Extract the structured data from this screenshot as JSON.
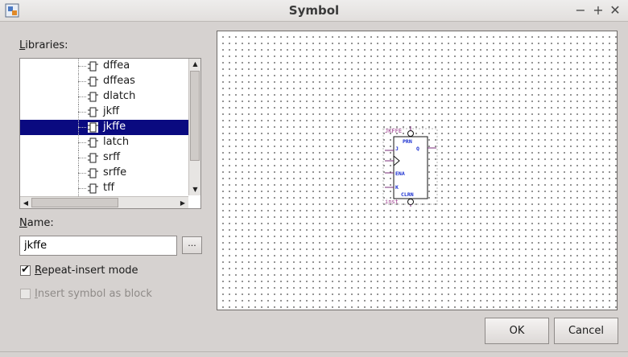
{
  "window": {
    "title": "Symbol",
    "controls": {
      "minimize": "−",
      "maximize": "+",
      "close": "✕"
    }
  },
  "libraries": {
    "label": "Libraries:",
    "label_underline": "L",
    "label_rest": "ibraries:",
    "items": [
      {
        "label": "dffea",
        "selected": false
      },
      {
        "label": "dffeas",
        "selected": false
      },
      {
        "label": "dlatch",
        "selected": false
      },
      {
        "label": "jkff",
        "selected": false
      },
      {
        "label": "jkffe",
        "selected": true
      },
      {
        "label": "latch",
        "selected": false
      },
      {
        "label": "srff",
        "selected": false
      },
      {
        "label": "srffe",
        "selected": false
      },
      {
        "label": "tff",
        "selected": false
      }
    ]
  },
  "name": {
    "label_underline": "N",
    "label_rest": "ame:",
    "value": "jkffe",
    "browse_label": "..."
  },
  "options": {
    "repeat_insert": {
      "underline": "R",
      "rest": "epeat-insert mode",
      "checked": true
    },
    "insert_block": {
      "underline": "I",
      "rest": "nsert symbol as block",
      "checked": false,
      "disabled": true
    }
  },
  "preview": {
    "symbol_name": "JKFFE",
    "instance": "inst",
    "pins": {
      "prn": "PRN",
      "j": "J",
      "q": "Q",
      "ena": "ENA",
      "k": "K",
      "clrn": "CLRN"
    }
  },
  "buttons": {
    "ok": "OK",
    "cancel": "Cancel"
  },
  "colors": {
    "selection": "#0a0a80",
    "pin_text": "#1a2fd0",
    "instance_text": "#9b3a8c"
  }
}
